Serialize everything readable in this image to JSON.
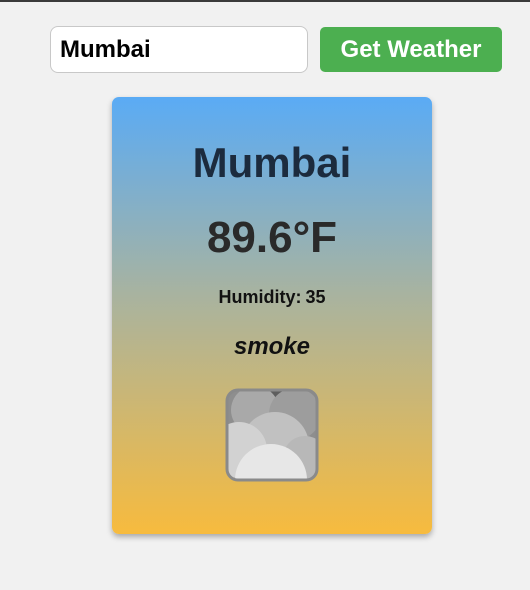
{
  "search": {
    "city_value": "Mumbai",
    "button_label": "Get Weather"
  },
  "weather": {
    "city": "Mumbai",
    "temperature": "89.6°F",
    "humidity_label": "Humidity:",
    "humidity_value": "35",
    "description": "smoke",
    "icon": "smoke-cloud-icon"
  },
  "colors": {
    "button": "#4caf50",
    "card_gradient_top": "#5aabf5",
    "card_gradient_middle": "#a8b3a0",
    "card_gradient_bottom": "#f7bb3e"
  }
}
